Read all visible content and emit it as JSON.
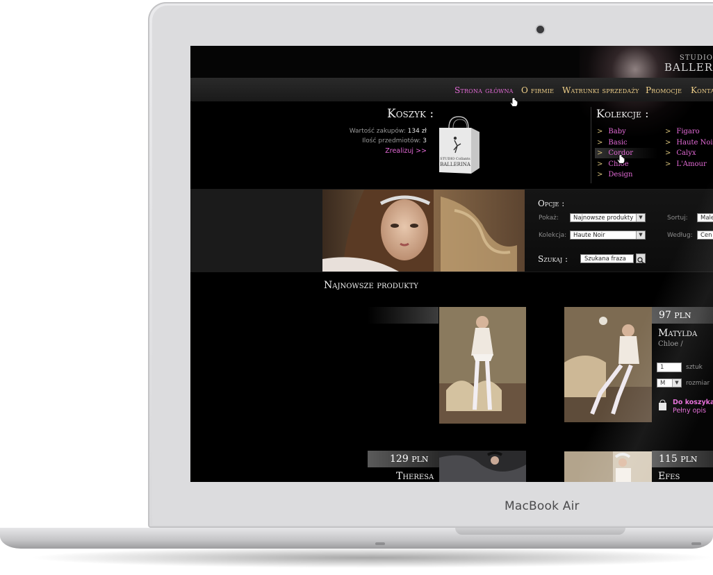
{
  "device": {
    "brand": "MacBook Air"
  },
  "site": {
    "logo_top": "STUDIO",
    "logo_main": "BALLER"
  },
  "nav": {
    "items": [
      "Strona główna",
      "O firmie",
      "Watrunki sprzedaży",
      "Promocje",
      "Konta"
    ],
    "active": "Strona główna"
  },
  "cart": {
    "title": "Koszyk :",
    "value_label": "Wartość zakupów:",
    "value": "134 zł",
    "count_label": "Ilość przedmiotów:",
    "count": "3",
    "checkout_link": "Zrealizuj >>",
    "bag_text_1": "STUDIO Collants",
    "bag_text_2": "BALLERINA"
  },
  "collections": {
    "title": "Kolekcje :",
    "left": [
      "Baby",
      "Basic",
      "Cordor",
      "Chloe",
      "Design"
    ],
    "right": [
      "Figaro",
      "Haute Noir",
      "Calyx",
      "L'Amour"
    ],
    "hovered": "Cordor",
    "bullet": ">"
  },
  "options": {
    "title": "Opcje :",
    "show_label": "Pokaż:",
    "show_value": "Najnowsze produkty",
    "collection_label": "Kolekcja:",
    "collection_value": "Haute Noir",
    "sort_label": "Sortuj:",
    "sort_value": "Male",
    "by_label": "Według:",
    "by_value": "Cen",
    "search_label": "Szukaj :",
    "search_placeholder": "Szukana fraza"
  },
  "products": {
    "title": "Najnowsze produkty",
    "items": [
      {
        "price": "97",
        "currency": "PLN",
        "name": "Matylda",
        "collection": "Chloe /",
        "qty": "1",
        "qty_label": "sztuk",
        "size": "M",
        "size_label": "rozmiar",
        "add_link": "Do koszyka",
        "details_link": "Pełny opis"
      },
      {
        "price": "129",
        "currency": "PLN",
        "name": "Theresa"
      },
      {
        "price": "115",
        "currency": "PLN",
        "name": "Efes"
      }
    ]
  },
  "colors": {
    "accent_pink": "#e36ad6",
    "nav_gold": "#f1d18a",
    "screen_bg": "#000000"
  }
}
